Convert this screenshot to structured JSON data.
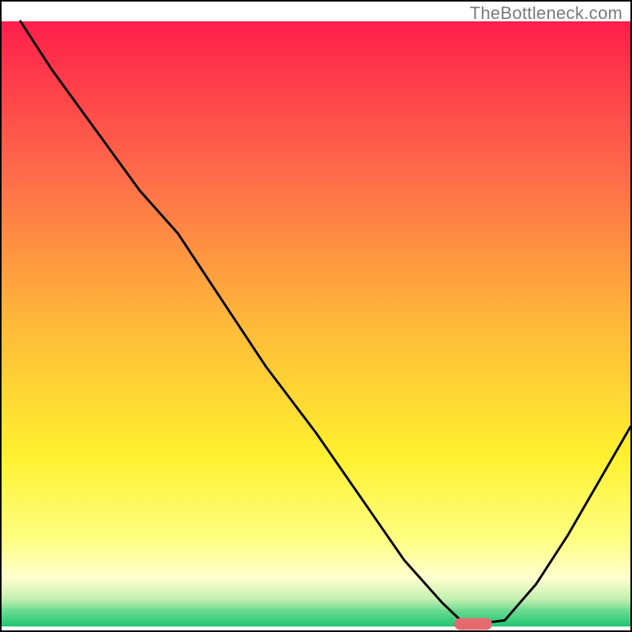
{
  "watermark": "TheBottleneck.com",
  "chart_data": {
    "type": "line",
    "title": "",
    "xlabel": "",
    "ylabel": "",
    "xlim": [
      0,
      100
    ],
    "ylim": [
      0,
      100
    ],
    "grid": false,
    "legend": false,
    "series": [
      {
        "name": "bottleneck-curve",
        "x": [
          3,
          8,
          15,
          22,
          28,
          35,
          42,
          50,
          58,
          64,
          70,
          73,
          76,
          80,
          85,
          90,
          95,
          100
        ],
        "y": [
          100,
          92,
          82,
          72,
          65,
          54,
          43,
          32,
          20,
          11,
          4,
          1,
          0.5,
          1,
          7,
          15,
          24,
          33
        ]
      }
    ],
    "marker": {
      "name": "optimum-marker",
      "x": 75,
      "y": 0.4,
      "color": "#e46a6f"
    },
    "background_gradient": {
      "stops": [
        {
          "offset": 0.0,
          "color": "#ff1f4b"
        },
        {
          "offset": 0.25,
          "color": "#ff6a4a"
        },
        {
          "offset": 0.5,
          "color": "#ffb939"
        },
        {
          "offset": 0.72,
          "color": "#fff12f"
        },
        {
          "offset": 0.86,
          "color": "#feff85"
        },
        {
          "offset": 0.92,
          "color": "#fefed0"
        },
        {
          "offset": 0.955,
          "color": "#c3f0b0"
        },
        {
          "offset": 0.975,
          "color": "#66da8f"
        },
        {
          "offset": 1.0,
          "color": "#1fc571"
        }
      ]
    }
  }
}
